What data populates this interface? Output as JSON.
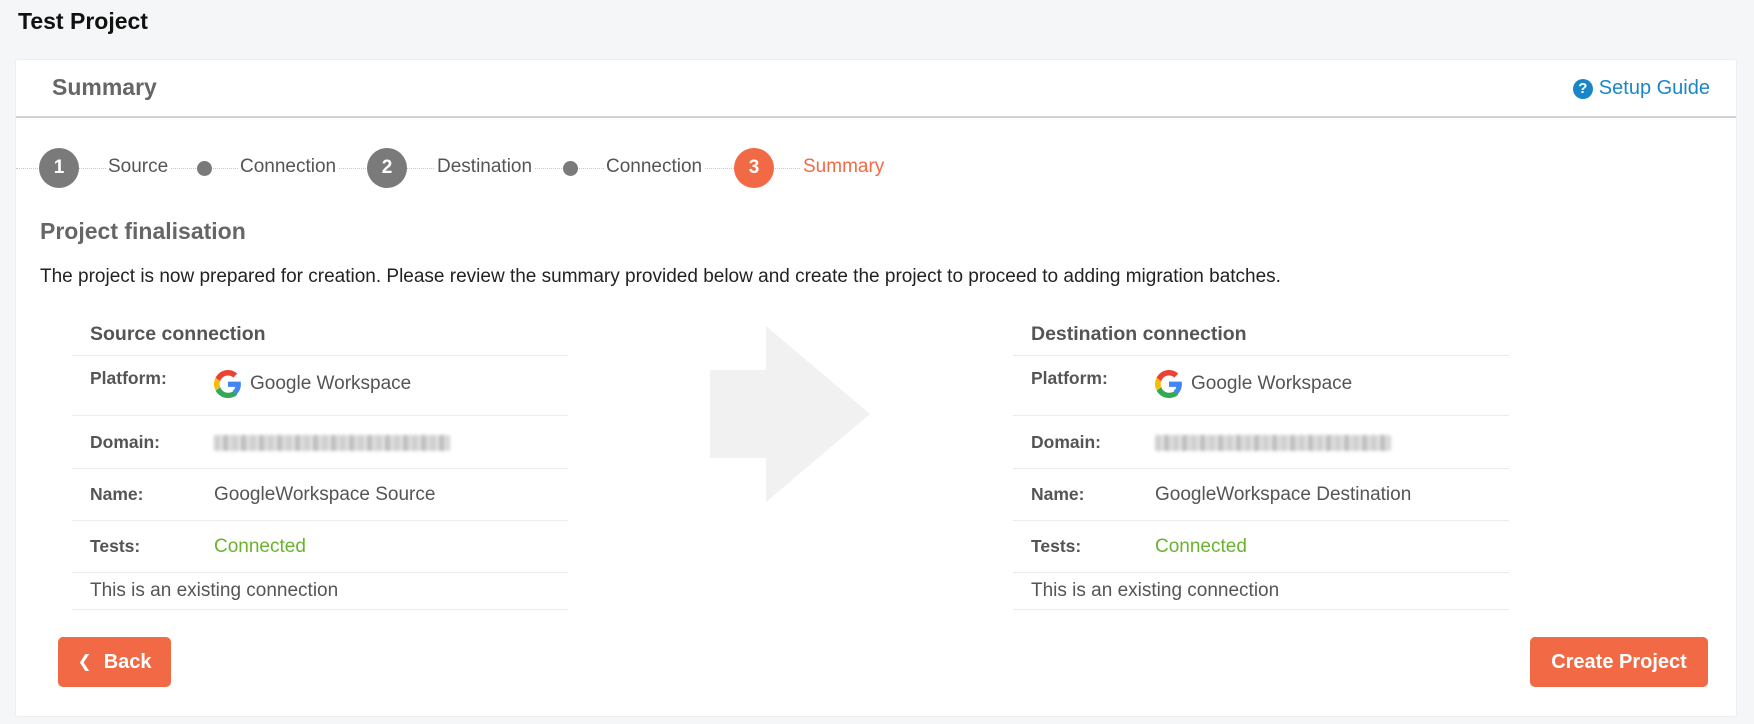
{
  "project": {
    "title": "Test Project"
  },
  "card": {
    "title": "Summary",
    "setup_guide": "Setup Guide"
  },
  "stepper": {
    "steps": [
      {
        "number": "1",
        "label": "Source"
      },
      {
        "label": "Connection"
      },
      {
        "number": "2",
        "label": "Destination"
      },
      {
        "label": "Connection"
      },
      {
        "number": "3",
        "label": "Summary",
        "active": true
      }
    ]
  },
  "finalisation": {
    "title": "Project finalisation",
    "description": "The project is now prepared for creation. Please review the summary provided below and create the project to proceed to adding migration batches."
  },
  "source": {
    "title": "Source connection",
    "platform_label": "Platform:",
    "platform_value": "Google Workspace",
    "domain_label": "Domain:",
    "name_label": "Name:",
    "name_value": "GoogleWorkspace Source",
    "tests_label": "Tests:",
    "tests_value": "Connected",
    "note": "This is an existing connection"
  },
  "destination": {
    "title": "Destination connection",
    "platform_label": "Platform:",
    "platform_value": "Google Workspace",
    "domain_label": "Domain:",
    "name_label": "Name:",
    "name_value": "GoogleWorkspace Destination",
    "tests_label": "Tests:",
    "tests_value": "Connected",
    "note": "This is an existing connection"
  },
  "buttons": {
    "back": "Back",
    "create": "Create Project"
  },
  "colors": {
    "accent": "#f26a45",
    "link": "#1a86c8",
    "success": "#6bb32e",
    "step": "#7a7a7a"
  },
  "icons": [
    "help-circle-icon",
    "google-icon",
    "chevron-left-icon",
    "arrow-right-icon"
  ]
}
